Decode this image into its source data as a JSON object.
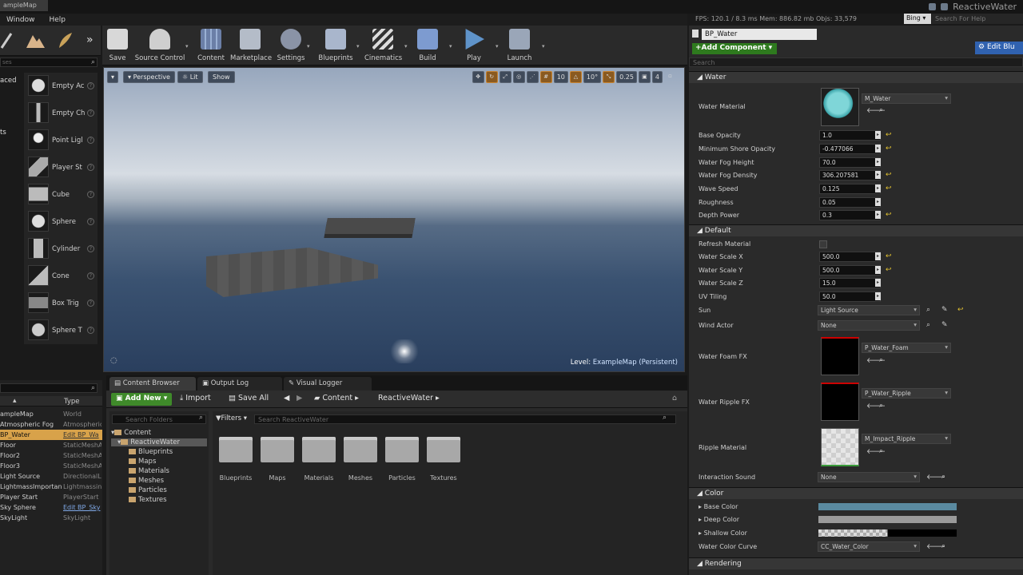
{
  "window": {
    "title": "ampleMap",
    "project_name": "ReactiveWater"
  },
  "menu": [
    "Window",
    "Help"
  ],
  "stats": {
    "fps": "FPS: 120.1 / 8.3 ms  Mem: 886.82 mb  Objs: 33,579"
  },
  "search_provider": "Bing",
  "help_placeholder": "Search For Help",
  "modes": {
    "search_placeholder": "ses",
    "categories": [
      "aced",
      "ts"
    ],
    "place_items": [
      "Empty Ac",
      "Empty Ch",
      "Point Ligl",
      "Player St",
      "Cube",
      "Sphere",
      "Cylinder",
      "Cone",
      "Box Trig",
      "Sphere T"
    ]
  },
  "toolbar": {
    "buttons": [
      "Save",
      "Source Control",
      "Content",
      "Marketplace",
      "Settings",
      "Blueprints",
      "Cinematics",
      "Build",
      "Play",
      "Launch"
    ]
  },
  "viewport": {
    "perspective": "Perspective",
    "lit": "Lit",
    "show": "Show",
    "grid": "10",
    "angle": "10°",
    "scale": "0.25",
    "camera_speed": "4",
    "level_label": "Level:",
    "level_name": "ExampleMap (Persistent)"
  },
  "outliner": {
    "type_header": "Type",
    "rows": [
      {
        "name": "ampleMap",
        "type": "World"
      },
      {
        "name": "Atmospheric Fog",
        "type": "Atmospheric"
      },
      {
        "name": "BP_Water",
        "type": "Edit BP_Wa"
      },
      {
        "name": "Floor",
        "type": "StaticMeshA"
      },
      {
        "name": "Floor2",
        "type": "StaticMeshA"
      },
      {
        "name": "Floor3",
        "type": "StaticMeshA"
      },
      {
        "name": "Light Source",
        "type": "DirectionalL"
      },
      {
        "name": "LightmassImportanc",
        "type": "Lightmassin"
      },
      {
        "name": "Player Start",
        "type": "PlayerStart"
      },
      {
        "name": "Sky Sphere",
        "type": "Edit BP_Sky"
      },
      {
        "name": "SkyLight",
        "type": "SkyLight"
      }
    ]
  },
  "bottom_tabs": [
    "Content Browser",
    "Output Log",
    "Visual Logger"
  ],
  "content_browser": {
    "add_new": "Add New",
    "import": "Import",
    "save_all": "Save All",
    "path": [
      "Content",
      "ReactiveWater"
    ],
    "folder_search": "Search Folders",
    "filters": "Filters",
    "asset_search": "Search ReactiveWater",
    "tree": [
      "Content",
      "ReactiveWater",
      "Blueprints",
      "Maps",
      "Materials",
      "Meshes",
      "Particles",
      "Textures"
    ],
    "folders": [
      "Blueprints",
      "Maps",
      "Materials",
      "Meshes",
      "Particles",
      "Textures"
    ]
  },
  "details": {
    "bp_name": "BP_Water",
    "add_component": "+Add Component",
    "edit_blueprint": "Edit Blu",
    "search_placeholder": "Search",
    "water": {
      "section": "Water",
      "material_label": "Water Material",
      "material_value": "M_Water",
      "props": [
        {
          "label": "Base Opacity",
          "value": "1.0"
        },
        {
          "label": "Minimum Shore Opacity",
          "value": "-0.477066"
        },
        {
          "label": "Water Fog Height",
          "value": "70.0"
        },
        {
          "label": "Water Fog Density",
          "value": "306.207581"
        },
        {
          "label": "Wave Speed",
          "value": "0.125"
        },
        {
          "label": "Roughness",
          "value": "0.05"
        },
        {
          "label": "Depth Power",
          "value": "0.3"
        }
      ]
    },
    "default": {
      "section": "Default",
      "refresh_label": "Refresh Material",
      "props": [
        {
          "label": "Water Scale X",
          "value": "500.0"
        },
        {
          "label": "Water Scale Y",
          "value": "500.0"
        },
        {
          "label": "Water Scale Z",
          "value": "15.0"
        },
        {
          "label": "UV Tiling",
          "value": "50.0"
        }
      ],
      "sun_label": "Sun",
      "sun_value": "Light Source",
      "wind_label": "Wind Actor",
      "wind_value": "None",
      "foam_label": "Water Foam FX",
      "foam_value": "P_Water_Foam",
      "ripple_label": "Water Ripple FX",
      "ripple_value": "P_Water_Ripple",
      "ripple_mat_label": "Ripple Material",
      "ripple_mat_value": "M_Impact_Ripple",
      "sound_label": "Interaction Sound",
      "sound_value": "None"
    },
    "color": {
      "section": "Color",
      "base_label": "Base Color",
      "base_color": "#5a8aa0",
      "deep_label": "Deep Color",
      "deep_color": "#9a9a9a",
      "shallow_label": "Shallow Color",
      "curve_label": "Water Color Curve",
      "curve_value": "CC_Water_Color"
    },
    "rendering": {
      "section": "Rendering"
    }
  }
}
